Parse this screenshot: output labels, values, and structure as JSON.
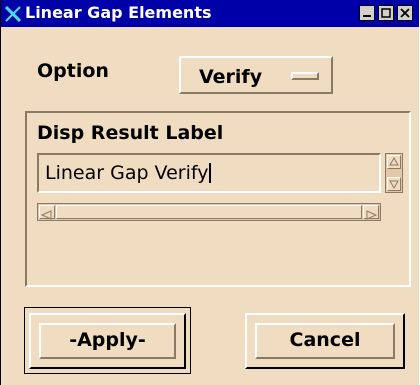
{
  "window": {
    "title": "Linear Gap Elements",
    "controls": {
      "minimize": "_",
      "maximize": "□",
      "close": "X"
    }
  },
  "option": {
    "label": "Option",
    "selected": "Verify"
  },
  "result": {
    "label": "Disp Result Label",
    "value": "Linear Gap Verify"
  },
  "buttons": {
    "apply": "-Apply-",
    "cancel": "Cancel"
  },
  "colors": {
    "titlebar": "#0000a8",
    "panel": "#f0dcc0"
  },
  "icons": {
    "app": "x-logo-icon",
    "scroll_up": "arrow-up-icon",
    "scroll_down": "arrow-down-icon",
    "scroll_left": "arrow-left-icon",
    "scroll_right": "arrow-right-icon"
  }
}
